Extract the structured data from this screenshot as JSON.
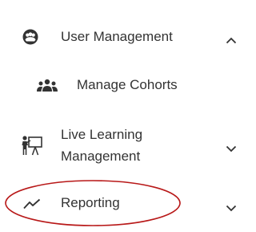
{
  "nav": {
    "items": [
      {
        "label": "User Management",
        "icon": "user-group-icon",
        "state": "expanded"
      },
      {
        "label": "Manage Cohorts",
        "icon": "cohort-icon"
      },
      {
        "label": "Live Learning Management",
        "icon": "presenter-board-icon",
        "state": "collapsed"
      },
      {
        "label": "Reporting",
        "icon": "trend-line-icon",
        "state": "collapsed"
      }
    ]
  },
  "colors": {
    "text": "#333333",
    "icon": "#333333",
    "annotation": "#b81818"
  }
}
